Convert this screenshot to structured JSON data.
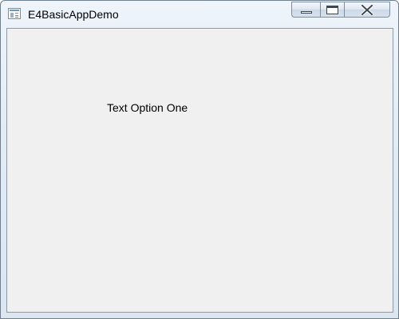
{
  "window": {
    "title": "E4BasicAppDemo",
    "icon": "app-window-icon"
  },
  "controls": {
    "minimize_icon": "minimize-icon",
    "maximize_icon": "maximize-icon",
    "close_icon": "close-icon"
  },
  "content": {
    "text_option": "Text Option One"
  },
  "colors": {
    "client_background": "#f0f0f0",
    "frame_background": "#dbe6f1",
    "text": "#000000"
  }
}
